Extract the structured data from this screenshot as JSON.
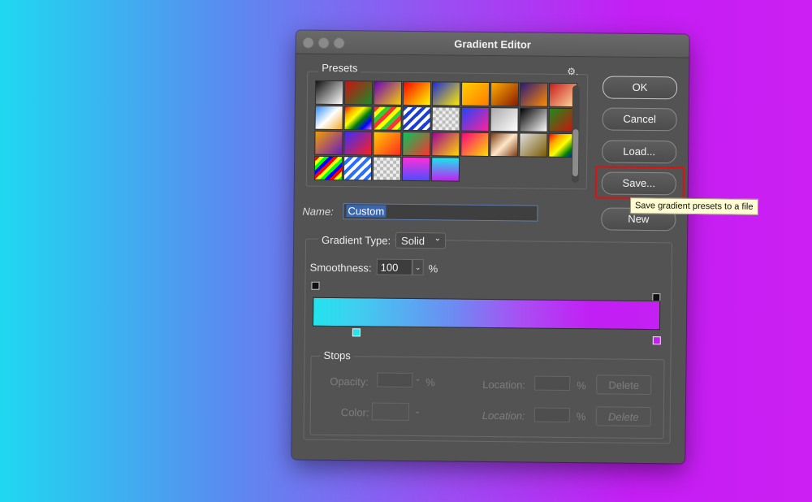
{
  "window": {
    "title": "Gradient Editor"
  },
  "presets": {
    "label": "Presets",
    "gear": "⚙.",
    "swatches": [
      "linear-gradient(135deg,#111,#fff)",
      "linear-gradient(135deg,#c11,#1a8a2a)",
      "linear-gradient(135deg,#6b00c0,#f8d000)",
      "linear-gradient(135deg,#f00,#ff0)",
      "linear-gradient(135deg,#1b2dd8,#ffeb00)",
      "linear-gradient(135deg,#ffd000,#ff7b00)",
      "linear-gradient(135deg,#ffae00,#8a1a00)",
      "linear-gradient(135deg,#2a1a7a,#ff8a00)",
      "linear-gradient(135deg,#c71c1c,#ffe0a0)",
      "linear-gradient(135deg,#2a8bff,#fff,#f2a82a)",
      "linear-gradient(135deg,red,orange,yellow,green,blue,violet)",
      "repeating-linear-gradient(135deg,#f33 0 5px,#ff0 5px 10px,#3c3 10px 15px)",
      "repeating-linear-gradient(135deg,#1a3dd8 0 4px,#fff 4px 8px)",
      "repeating-conic-gradient(#bbb 0 25%,#eee 0 50%) 0 0/8px 8px",
      "linear-gradient(135deg,#2244ff,#ff2299)",
      "linear-gradient(135deg,#aaa,#fff)",
      "linear-gradient(135deg,#000,#fff)",
      "linear-gradient(135deg,#1d8b1d,#d60c0c)",
      "linear-gradient(135deg,#f2a000,#6a1ac0)",
      "linear-gradient(135deg,#3b2dff,#ff1e1e)",
      "linear-gradient(135deg,#ffcc00,#ff2b1e)",
      "linear-gradient(135deg,#00c85a,#ff3030)",
      "linear-gradient(135deg,#a0009a,#ffd800)",
      "linear-gradient(135deg,#ff0080,#ffe000)",
      "linear-gradient(135deg,#7a3a10,#ffe6c8,#7a3a10)",
      "linear-gradient(135deg,#e0e0e0,#7a5a00)",
      "linear-gradient(135deg,red,orange,yellow,green,blue)",
      "repeating-linear-gradient(135deg,red 0 4px,yellow 4px 8px,lime 8px 12px,blue 12px 16px)",
      "repeating-linear-gradient(135deg,#fff 0 4px,#2a6dff 4px 8px)",
      "repeating-conic-gradient(#bbb 0 25%,#eee 0 50%) 0 0/8px 8px",
      "linear-gradient(180deg,#ff2fd8,#4f4cff)",
      "linear-gradient(180deg,#19e7ee,#c41ff3)"
    ]
  },
  "buttons": {
    "ok": "OK",
    "cancel": "Cancel",
    "load": "Load...",
    "save": "Save...",
    "new": "New"
  },
  "tooltip": "Save gradient presets to a file",
  "name": {
    "label": "Name:",
    "value": "Custom"
  },
  "gradient": {
    "type_label": "Gradient Type:",
    "type_value": "Solid",
    "smoothness_label": "Smoothness:",
    "smoothness_value": "100",
    "smoothness_unit": "%",
    "start_color": "#22e3ee",
    "end_color": "#c41ff3"
  },
  "stops": {
    "label": "Stops",
    "opacity_label": "Opacity:",
    "opacity_unit": "%",
    "location_label": "Location:",
    "location_unit": "%",
    "color_label": "Color:",
    "delete_label": "Delete"
  }
}
